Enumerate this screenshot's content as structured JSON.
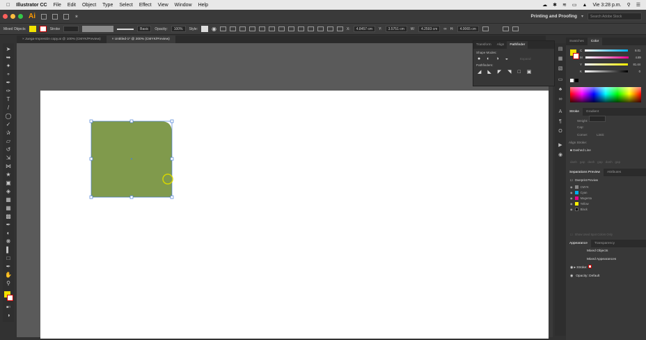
{
  "menubar": {
    "app_name": "Illustrator CC",
    "items": [
      "File",
      "Edit",
      "Object",
      "Type",
      "Select",
      "Effect",
      "View",
      "Window",
      "Help"
    ],
    "clock": "Vie 3:28 p.m."
  },
  "appbar": {
    "logo": "Ai",
    "workspace": "Printing and Proofing",
    "search_placeholder": "Search Adobe Stock"
  },
  "control": {
    "selection_label": "Mixed Objects",
    "stroke_label": "Stroke",
    "brush": "Basic",
    "opacity_label": "Opacity:",
    "opacity_value": "100%",
    "style_label": "Style:",
    "x_label": "X:",
    "x_value": "4.8457 cm",
    "y_label": "Y:",
    "y_value": "3.5751 cm",
    "w_label": "W:",
    "w_value": "4.2593 cm",
    "h_label": "H:",
    "h_value": "4.0065 cm",
    "fill_color": "#f2e200",
    "accent": "#ff9a00"
  },
  "tabs": [
    {
      "label": "Juega-Impresión copy.ai @ 100% (CMYK/Preview)"
    },
    {
      "label": "Untitled-1* @ 200% (CMYK/Preview)"
    }
  ],
  "pathfinder": {
    "tabs": [
      "Transform",
      "Align",
      "Pathfinder"
    ],
    "shape_modes_label": "Shape Modes:",
    "expand_label": "Expand",
    "pathfinders_label": "Pathfinders:"
  },
  "color_panel": {
    "tabs": [
      "Swatches",
      "Color"
    ],
    "channels": [
      {
        "name": "C",
        "value": "8.01",
        "color": "#00aeef"
      },
      {
        "name": "M",
        "value": "4.89",
        "color": "#ec008c"
      },
      {
        "name": "Y",
        "value": "81.44",
        "color": "#fff200"
      },
      {
        "name": "K",
        "value": "0",
        "color": "#000000"
      }
    ]
  },
  "stroke_panel": {
    "tabs": [
      "Stroke",
      "Gradient"
    ],
    "weight_label": "Weight:",
    "cap_label": "Cap:",
    "corner_label": "Corner:",
    "limit_label": "Limit:",
    "align_label": "Align Stroke:",
    "dashed_label": "Dashed Line",
    "dash_label": "dash",
    "gap_label": "gap"
  },
  "separations": {
    "tabs": [
      "Separations Preview",
      "Attributes"
    ],
    "overprint_label": "Overprint Preview",
    "inks": [
      {
        "name": "CMYK",
        "color": "#888888"
      },
      {
        "name": "Cyan",
        "color": "#00aeef"
      },
      {
        "name": "Magenta",
        "color": "#ec008c"
      },
      {
        "name": "Yellow",
        "color": "#fff200"
      },
      {
        "name": "Black",
        "color": "#000000"
      }
    ],
    "spot_only_label": "Show Used Spot Colors Only"
  },
  "appearance": {
    "tabs": [
      "Appearance",
      "Transparency"
    ],
    "title": "Mixed Objects",
    "subtitle": "Mixed Appearances",
    "stroke_label": "Stroke:",
    "opacity_label": "Opacity:",
    "opacity_value": "Default"
  },
  "artwork": {
    "fill_color": "#809a4c",
    "selection_color": "#4a7fd4",
    "highlight_color": "#d6d600"
  }
}
